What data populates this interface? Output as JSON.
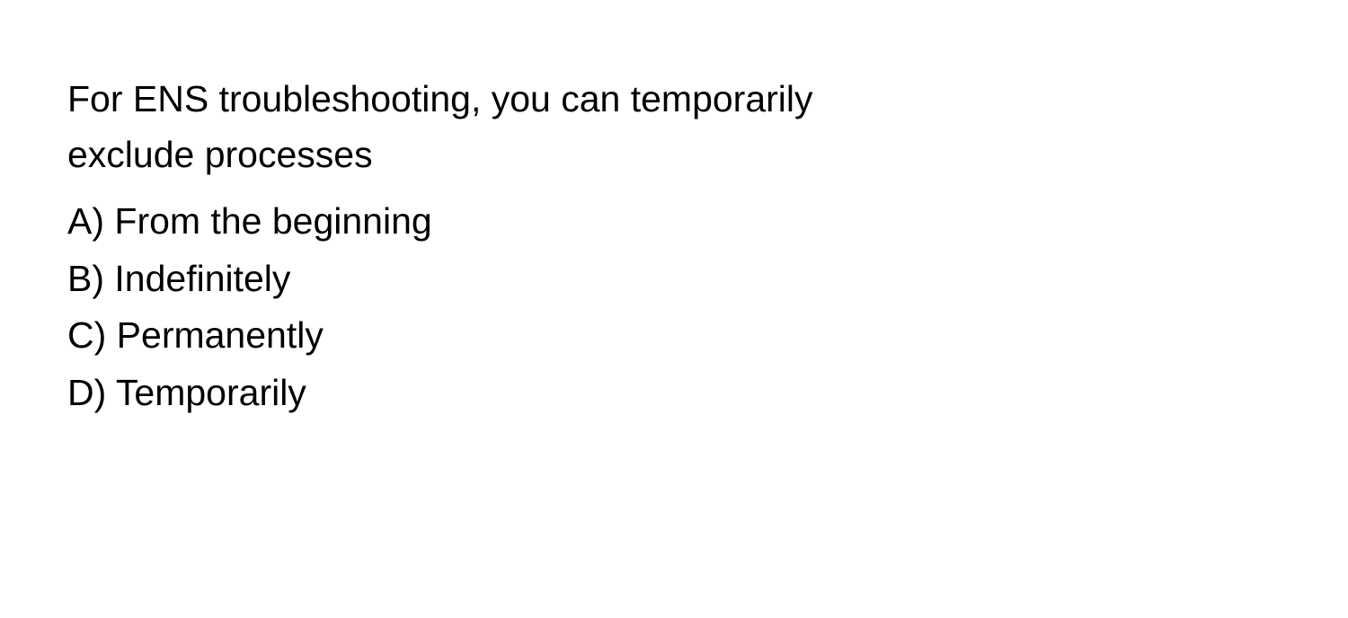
{
  "question": {
    "text": "For ENS troubleshooting, you can temporarily exclude processes",
    "options": [
      {
        "label": "A)",
        "text": "From the beginning"
      },
      {
        "label": "B)",
        "text": "Indefinitely"
      },
      {
        "label": "C)",
        "text": "Permanently"
      },
      {
        "label": "D)",
        "text": "Temporarily"
      }
    ]
  }
}
